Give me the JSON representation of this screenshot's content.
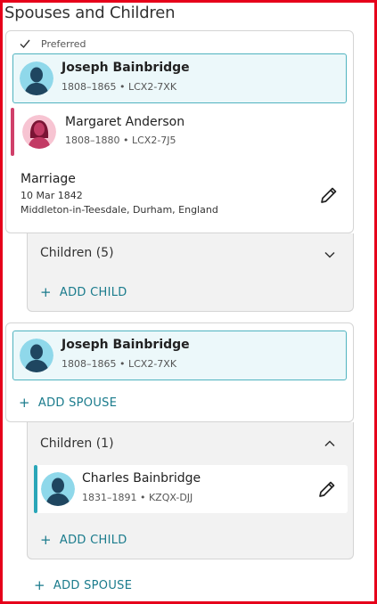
{
  "section": {
    "title": "Spouses and Children"
  },
  "family1": {
    "preferred_label": "Preferred",
    "person": {
      "name": "Joseph Bainbridge",
      "meta": "1808–1865 • LCX2-7XK"
    },
    "spouse": {
      "name": "Margaret Anderson",
      "meta": "1808–1880 • LCX2-7J5"
    },
    "event": {
      "title": "Marriage",
      "date": "10 Mar 1842",
      "place": "Middleton-in-Teesdale, Durham, England"
    },
    "children": {
      "header": "Children (5)",
      "add_child": "ADD CHILD"
    }
  },
  "family2": {
    "person": {
      "name": "Joseph Bainbridge",
      "meta": "1808–1865 • LCX2-7XK"
    },
    "add_spouse": "ADD SPOUSE",
    "children": {
      "header": "Children (1)",
      "items": [
        {
          "name": "Charles Bainbridge",
          "meta": "1831–1891 • KZQX-DJJ"
        }
      ],
      "add_child": "ADD CHILD"
    }
  },
  "footer": {
    "add_spouse": "ADD SPOUSE"
  },
  "colors": {
    "accent": "#1a7b8c",
    "selected_border": "#4fb3bf",
    "female_bar": "#d0406a",
    "child_bar": "#2aa6b8",
    "frame": "#e6001a"
  },
  "icons": {
    "check": "check-icon",
    "edit": "pencil-icon",
    "expand": "chevron-down-icon",
    "collapse": "chevron-up-icon",
    "add": "plus-icon"
  }
}
